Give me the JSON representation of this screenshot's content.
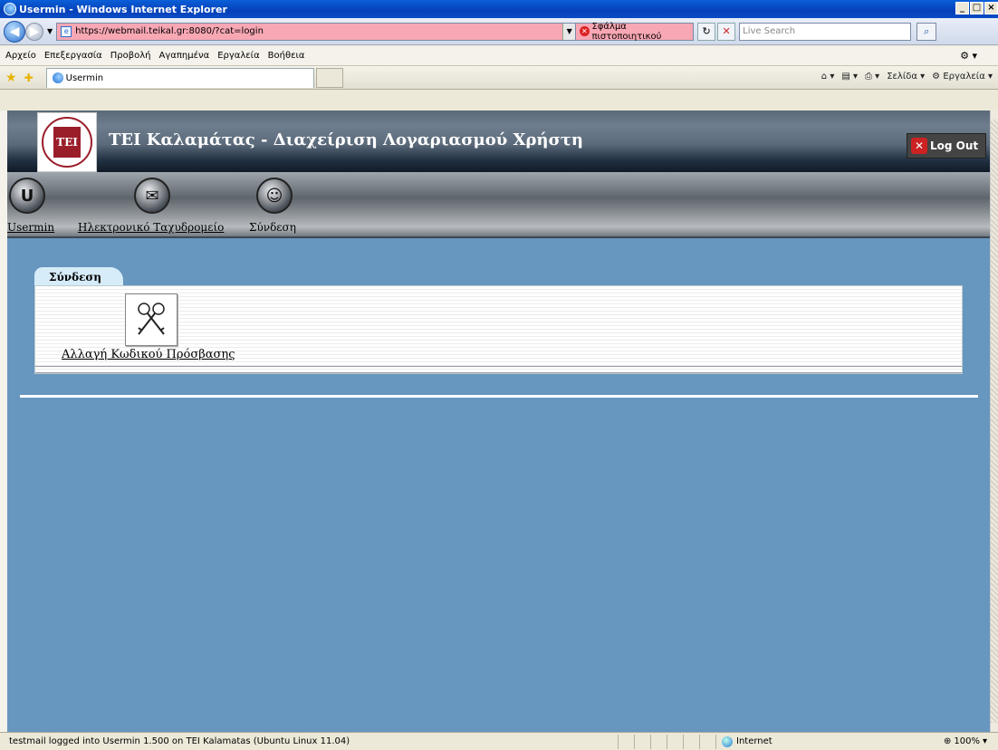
{
  "window": {
    "title": "Usermin - Windows Internet Explorer"
  },
  "browser": {
    "url": "https://webmail.teikal.gr:8080/?cat=login",
    "cert_error": "Σφάλμα πιστοποιητικού",
    "search_placeholder": "Live Search",
    "menu": [
      "Αρχείο",
      "Επεξεργασία",
      "Προβολή",
      "Αγαπημένα",
      "Εργαλεία",
      "Βοήθεια"
    ],
    "tab_title": "Usermin",
    "commands": {
      "page": "Σελίδα",
      "tools": "Εργαλεία"
    }
  },
  "header": {
    "title": "ΤΕΙ Καλαμάτας - Διαχείριση Λογαριασμού Χρήστη",
    "logout_label": "Log Out"
  },
  "nav": [
    {
      "label": "Usermin",
      "icon": "usermin-icon"
    },
    {
      "label": "Ηλεκτρονικό Ταχυδρομείο",
      "icon": "mail-icon"
    },
    {
      "label": "Σύνδεση",
      "icon": "login-icon"
    }
  ],
  "panel": {
    "tab_label": "Σύνδεση",
    "option_label": "Αλλαγή Κωδικού Πρόσβασης",
    "option_icon": "keys-icon"
  },
  "status": {
    "text": "testmail logged into Usermin 1.500 on TEI Kalamatas (Ubuntu Linux 11.04)",
    "zone": "Internet",
    "zoom": "100%"
  },
  "colors": {
    "page_background": "#6796bf",
    "url_error": "#f8a7b4"
  }
}
